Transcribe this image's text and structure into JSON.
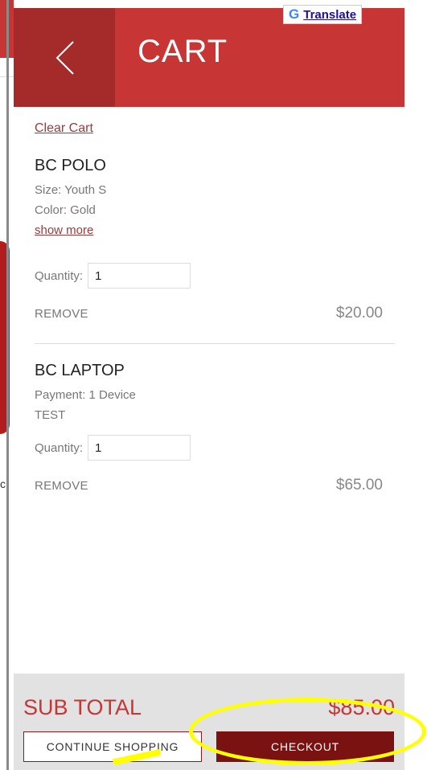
{
  "translate": {
    "label": "Translate",
    "icon": "google-g-icon"
  },
  "header": {
    "title": "CART",
    "back_icon": "chevron-left-icon"
  },
  "cart": {
    "clear_label": "Clear Cart",
    "items": [
      {
        "name": "BC POLO",
        "options": [
          "Size: Youth S",
          "Color: Gold"
        ],
        "show_more": "show more",
        "quantity_label": "Quantity:",
        "quantity": "1",
        "remove_label": "REMOVE",
        "price": "$20.00"
      },
      {
        "name": "BC LAPTOP",
        "options": [
          "Payment: 1 Device",
          "TEST"
        ],
        "quantity_label": "Quantity:",
        "quantity": "1",
        "remove_label": "REMOVE",
        "price": "$65.00"
      }
    ]
  },
  "footer": {
    "subtotal_label": "SUB TOTAL",
    "subtotal_value": "$85.00",
    "continue_label": "CONTINUE SHOPPING",
    "checkout_label": "CHECKOUT"
  },
  "background": {
    "partial_text": "c"
  },
  "colors": {
    "brand_red": "#c73535",
    "dark_red": "#7a1212",
    "highlight": "#ffff00"
  }
}
